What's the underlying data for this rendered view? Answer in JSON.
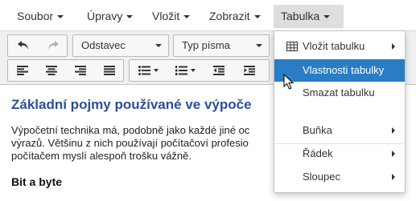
{
  "menubar": {
    "items": [
      {
        "label": "Soubor"
      },
      {
        "label": "Úpravy"
      },
      {
        "label": "Vložit"
      },
      {
        "label": "Zobrazit"
      },
      {
        "label": "Tabulka",
        "active": true
      }
    ]
  },
  "toolbar": {
    "undo_icon": "undo-icon",
    "redo_icon": "redo-icon",
    "format_select": "Odstavec",
    "font_select": "Typ písma",
    "row2_icons": [
      "align-left-icon",
      "align-center-icon",
      "align-right-icon",
      "align-justify-icon",
      "bullet-list-icon",
      "numbered-list-icon",
      "outdent-icon",
      "indent-icon"
    ]
  },
  "content": {
    "heading": "Základní pojmy používané ve výpoče",
    "paragraph_lines": [
      "Výpočetní technika má, podobně jako každé jiné oc",
      "výrazů. Většinu z nich používají počítačoví profesio",
      "počítačem myslí alespoň trošku vážně."
    ],
    "subheading": "Bit a byte"
  },
  "dropdown": {
    "items": [
      {
        "label": "Vložit tabulku",
        "icon": "table-icon",
        "submenu": true
      },
      {
        "label": "Vlastnosti tabulky",
        "selected": true
      },
      {
        "label": "Smazat tabulku"
      },
      {
        "label": "Buňka",
        "submenu": true
      },
      {
        "label": "Řádek",
        "submenu": true
      },
      {
        "label": "Sloupec",
        "submenu": true
      }
    ]
  },
  "colors": {
    "heading": "#2c4f96",
    "selected_item": "#2a7dc4",
    "active_menu_bg": "#dedede",
    "toolbar_bg": "#f0f0f0"
  }
}
